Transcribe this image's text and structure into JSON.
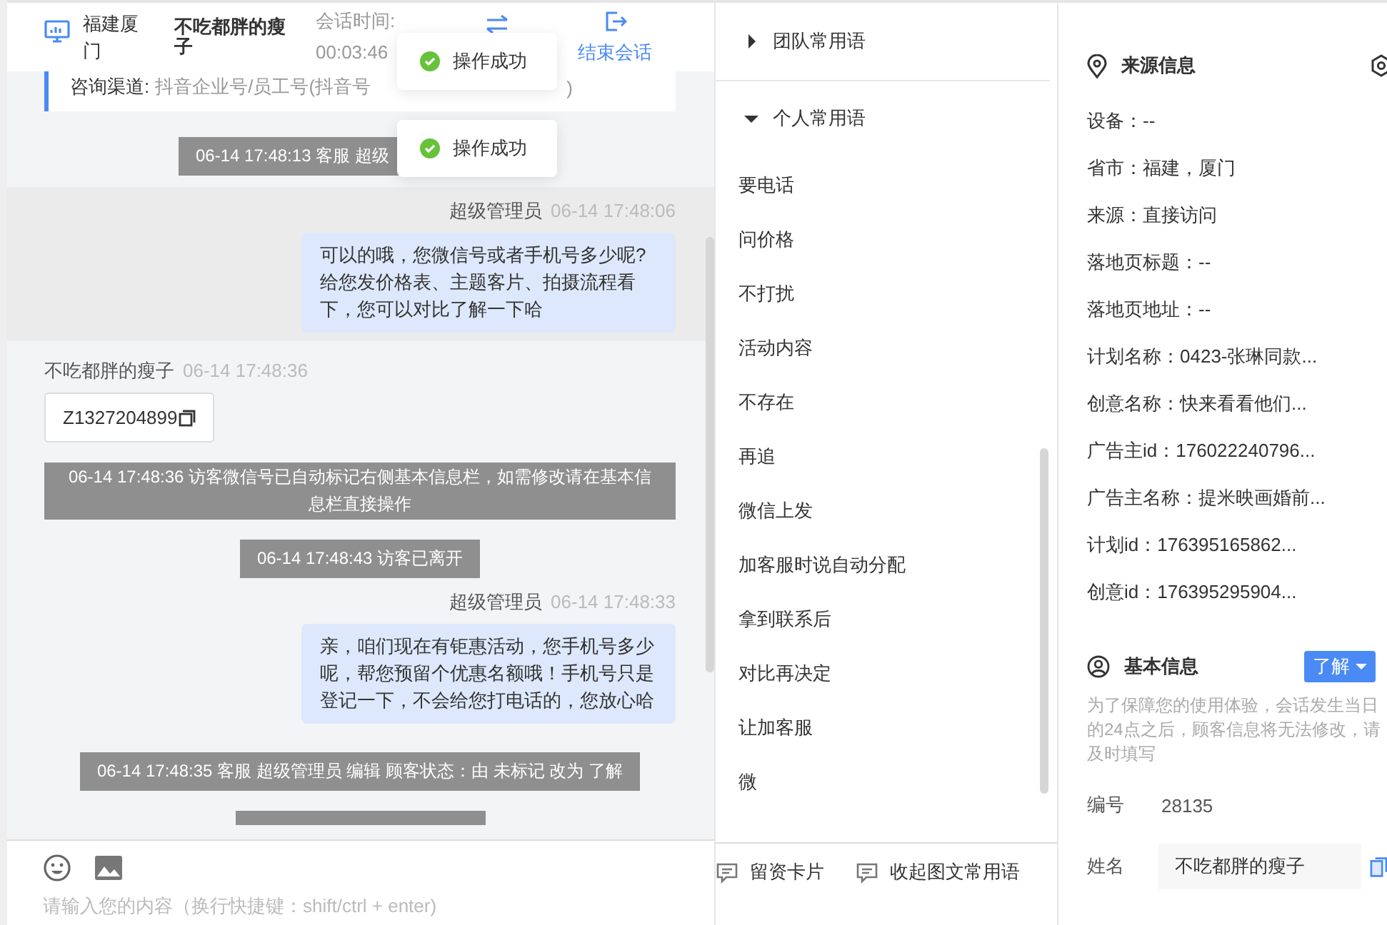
{
  "header": {
    "location": "福建厦门",
    "customer": "不吃都胖的瘦子",
    "session_label": "会话时间:",
    "session_time": "00:03:46",
    "end_label": "结束会话"
  },
  "toasts": [
    {
      "text": "操作成功"
    },
    {
      "text": "操作成功"
    }
  ],
  "channel_card": {
    "label": "咨询渠道:",
    "value": "抖音企业号/员工号(抖音号",
    "value_tail": ")"
  },
  "messages": [
    {
      "kind": "system",
      "text": "06-14 17:48:13 客服 超级",
      "covered": true
    },
    {
      "kind": "agent",
      "sender": "超级管理员",
      "time": "06-14 17:48:06",
      "text": "可以的哦，您微信号或者手机号多少呢?给您发价格表、主题客片、拍摄流程看下，您可以对比了解一下哈",
      "highlighted": true
    },
    {
      "kind": "visitor",
      "sender": "不吃都胖的瘦子",
      "time": "06-14 17:48:36",
      "card": "Z1327204899"
    },
    {
      "kind": "system",
      "text": "06-14 17:48:36 访客微信号已自动标记右侧基本信息栏，如需修改请在基本信息栏直接操作",
      "wide": true
    },
    {
      "kind": "system",
      "text": "06-14 17:48:43 访客已离开"
    },
    {
      "kind": "agent",
      "sender": "超级管理员",
      "time": "06-14 17:48:33",
      "text": "亲，咱们现在有钜惠活动，您手机号多少呢，帮您预留个优惠名额哦！手机号只是登记一下，不会给您打电话的，您放心哈",
      "highlighted": false
    },
    {
      "kind": "system",
      "text": "06-14 17:48:35 客服 超级管理员 编辑 顾客状态：由 未标记 改为 了解"
    }
  ],
  "input": {
    "placeholder": "请输入您的内容（换行快捷键：shift/ctrl + enter)"
  },
  "phrases": {
    "groups": [
      {
        "title": "团队常用语",
        "expanded": false
      },
      {
        "title": "个人常用语",
        "expanded": true,
        "items": [
          "要电话",
          "问价格",
          "不打扰",
          "活动内容",
          "不存在",
          "再追",
          "微信上发",
          "加客服时说自动分配",
          "拿到联系后",
          "对比再决定",
          "让加客服",
          "微"
        ]
      }
    ],
    "actions": [
      "留资卡片",
      "收起图文常用语"
    ]
  },
  "source_info": {
    "title": "来源信息",
    "rows": [
      "设备：--",
      "省市：福建，厦门",
      "来源：直接访问",
      "落地页标题：--",
      "落地页地址：--",
      "计划名称：0423-张琳同款...",
      "创意名称：快来看看他们...",
      "广告主id：176022240796...",
      "广告主名称：提米映画婚前...",
      "计划id：176395165862...",
      "创意id：176395295904..."
    ]
  },
  "basic_info": {
    "title": "基本信息",
    "status": "了解",
    "note": "为了保障您的使用体验，会话发生当日的24点之后，顾客信息将无法修改，请及时填写",
    "fields": [
      {
        "kind": "text",
        "label": "编号",
        "value": "28135"
      },
      {
        "kind": "input",
        "label": "姓名",
        "value": "不吃都胖的瘦子"
      }
    ]
  }
}
